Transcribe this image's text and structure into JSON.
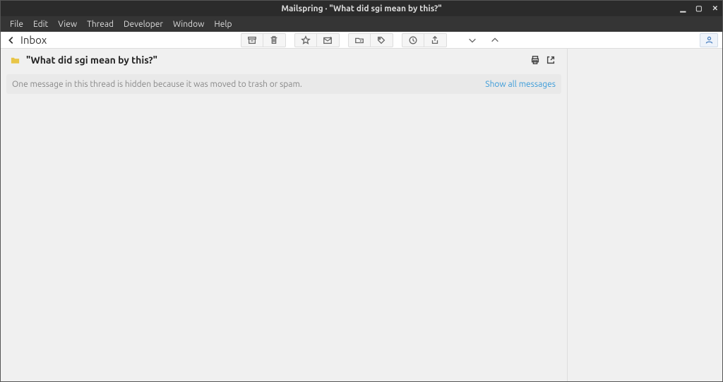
{
  "titlebar": {
    "title": "Mailspring · \"What did sgi mean by this?\""
  },
  "menubar": {
    "items": [
      "File",
      "Edit",
      "View",
      "Thread",
      "Developer",
      "Window",
      "Help"
    ]
  },
  "toolbar": {
    "folder": "Inbox"
  },
  "subject": {
    "text": "\"What did sgi mean by this?\""
  },
  "notice": {
    "text": "One message in this thread is hidden because it was moved to trash or spam.",
    "link": "Show all messages"
  }
}
